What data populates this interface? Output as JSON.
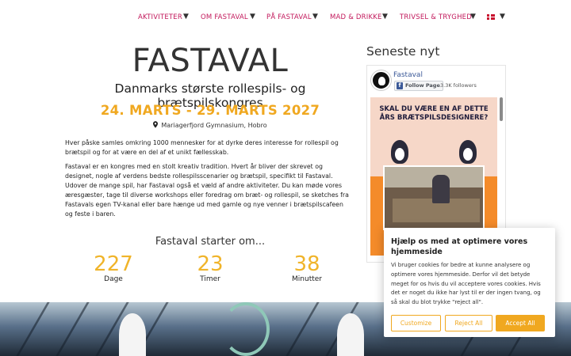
{
  "nav": {
    "items": [
      {
        "label": "AKTIVITETER"
      },
      {
        "label": "OM FASTAVAL"
      },
      {
        "label": "PÅ FASTAVAL"
      },
      {
        "label": "MAD & DRIKKE"
      },
      {
        "label": "TRIVSEL & TRYGHED"
      }
    ],
    "caret": "▼",
    "language_flag": "danish-flag"
  },
  "main": {
    "title": "FASTAVAL",
    "subtitle": "Danmarks største rollespils- og brætspilskongres",
    "dates": "24. MARTS - 29. MARTS 2027",
    "location": "Mariagerfjord Gymnasium, Hobro",
    "paragraph1": "Hver påske samles omkring 1000 mennesker for at dyrke deres interesse for rollespil og brætspil og for at være en del af et unikt fællesskab.",
    "paragraph2": "Fastaval er en kongres med en stolt kreativ tradition. Hvert år bliver der skrevet og designet, nogle af verdens bedste rollespilsscenarier og brætspil, specifikt til Fastaval. Udover de mange spil, har Fastaval også et væld af andre aktiviteter. Du kan møde vores æresgæster, tage til diverse workshops eller foredrag om bræt- og rollespil, se sketches fra Fastavals egen TV-kanal eller bare hænge ud med gamle og nye venner i brætspilscafeen og feste i baren.",
    "countdown_heading": "Fastaval starter om...",
    "countdown": [
      {
        "value": "227",
        "label": "Dage"
      },
      {
        "value": "23",
        "label": "Timer"
      },
      {
        "value": "38",
        "label": "Minutter"
      }
    ]
  },
  "sidebar": {
    "heading": "Seneste nyt",
    "facebook": {
      "page_name": "Fastaval",
      "follow_label": "Follow Page",
      "followers": "3.3K followers",
      "post_headline": "SKAL DU VÆRE EN AF DETTE ÅRS BRÆTSPILSDESIGNERE?"
    }
  },
  "cookie": {
    "title": "Hjælp os med at optimere vores hjemmeside",
    "body": "Vi bruger cookies for bedre at kunne analysere og optimere vores hjemmeside. Derfor vil det betyde meget for os hvis du vil acceptere vores cookies. Hvis det er noget du ikke har lyst til er der ingen tvang, og så skal du blot trykke \"reject all\".",
    "customize_label": "Customize",
    "reject_label": "Reject All",
    "accept_label": "Accept All"
  },
  "colors": {
    "accent": "#f0a820",
    "nav_link": "#c2185b",
    "facebook_blue": "#3b5998"
  }
}
